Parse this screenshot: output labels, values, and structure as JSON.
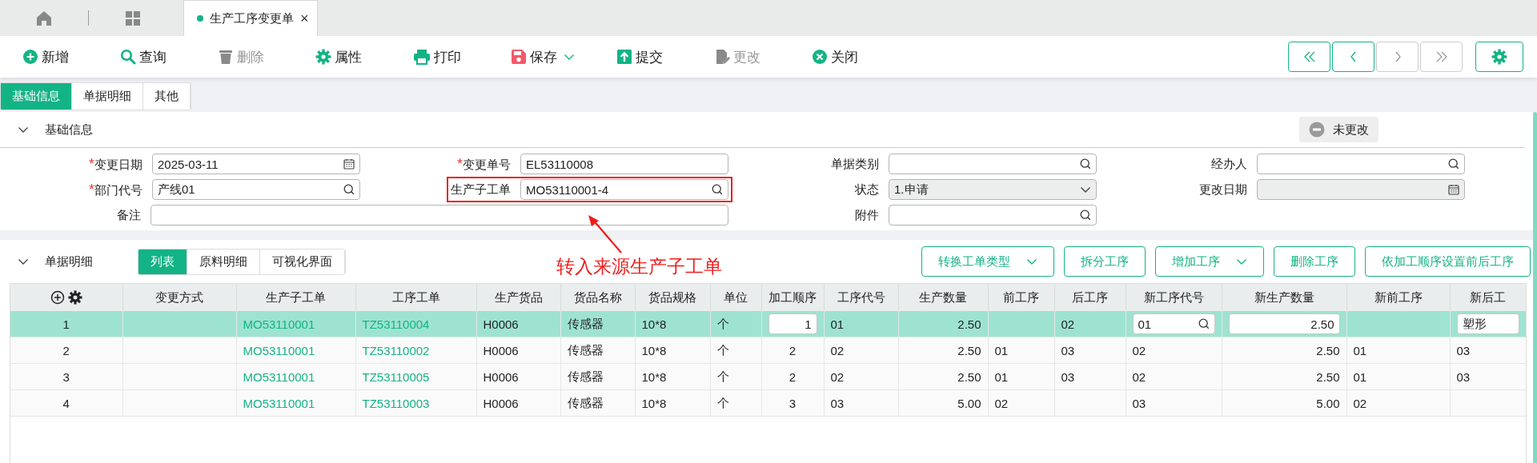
{
  "tab_bar": {
    "tabs": [
      {
        "label": "生产工序变更单",
        "selected": true,
        "close": "×"
      }
    ]
  },
  "toolbar": [
    {
      "label": "新增",
      "disabled": false
    },
    {
      "label": "查询",
      "disabled": false
    },
    {
      "label": "删除",
      "disabled": true
    },
    {
      "label": "属性",
      "disabled": false
    },
    {
      "label": "打印",
      "disabled": false
    },
    {
      "label": "保存",
      "disabled": false,
      "has_menu": true
    },
    {
      "label": "提交",
      "disabled": false
    },
    {
      "label": "更改",
      "disabled": true
    },
    {
      "label": "关闭",
      "disabled": false
    }
  ],
  "pager": [
    {
      "disabled": false
    },
    {
      "disabled": false
    },
    {
      "disabled": true
    },
    {
      "disabled": true
    }
  ],
  "form_tabs": [
    {
      "label": "基础信息",
      "selected": true
    },
    {
      "label": "单据明细",
      "selected": false
    },
    {
      "label": "其他",
      "selected": false
    }
  ],
  "basic_info": {
    "title": "基础信息",
    "expanded": true,
    "status": "未更改",
    "fields": [
      {
        "label": "变更日期",
        "kind": "date",
        "required_mark": "*",
        "disabled": false,
        "highlighted": false,
        "value": "2025-03-11"
      },
      {
        "label": "变更单号",
        "kind": "text",
        "required_mark": "*",
        "disabled": false,
        "highlighted": false,
        "value": "EL53110008"
      },
      {
        "label": "单据类别",
        "kind": "lookup",
        "disabled": false,
        "highlighted": false
      },
      {
        "label": "经办人",
        "kind": "lookup",
        "disabled": false,
        "highlighted": false
      },
      {
        "label": "部门代号",
        "kind": "lookup",
        "required_mark": "*",
        "disabled": false,
        "highlighted": false,
        "value": "产线01"
      },
      {
        "label": "生产子工单",
        "kind": "lookup",
        "disabled": false,
        "highlighted": true,
        "value": "MO53110001-4"
      },
      {
        "label": "状态",
        "kind": "select",
        "disabled": true,
        "highlighted": false,
        "value": "1.申请"
      },
      {
        "label": "更改日期",
        "kind": "date",
        "disabled": true,
        "highlighted": false
      },
      {
        "label": "备注",
        "kind": "note",
        "disabled": false,
        "highlighted": false
      },
      {
        "label": "附件",
        "kind": "lookup",
        "disabled": false,
        "highlighted": false
      }
    ]
  },
  "annotation": {
    "text": "转入来源生产子工单"
  },
  "detail": {
    "title": "单据明细",
    "expanded": true,
    "views": [
      {
        "label": "列表",
        "selected": true
      },
      {
        "label": "原料明细",
        "selected": false
      },
      {
        "label": "可视化界面",
        "selected": false
      }
    ],
    "actions": [
      {
        "label": "转换工单类型",
        "has_menu": true
      },
      {
        "label": "拆分工序",
        "has_menu": false
      },
      {
        "label": "增加工序",
        "has_menu": true
      },
      {
        "label": "删除工序",
        "has_menu": false
      },
      {
        "label": "依加工顺序设置前后工序",
        "has_menu": false
      }
    ],
    "table": {
      "columns": [
        {
          "kind": "index"
        },
        {
          "label": "变更方式",
          "kind": "text"
        },
        {
          "label": "生产子工单",
          "kind": "link"
        },
        {
          "label": "工序工单",
          "kind": "link"
        },
        {
          "label": "生产货品",
          "kind": "text"
        },
        {
          "label": "货品名称",
          "kind": "text"
        },
        {
          "label": "货品规格",
          "kind": "text"
        },
        {
          "label": "单位",
          "kind": "text"
        },
        {
          "label": "加工顺序",
          "kind": "center"
        },
        {
          "label": "工序代号",
          "kind": "text"
        },
        {
          "label": "生产数量",
          "kind": "number"
        },
        {
          "label": "前工序",
          "kind": "text"
        },
        {
          "label": "后工序",
          "kind": "text"
        },
        {
          "label": "新工序代号",
          "kind": "text"
        },
        {
          "label": "新生产数量",
          "kind": "number"
        },
        {
          "label": "新前工序",
          "kind": "text"
        },
        {
          "label": "新后工",
          "kind": "text"
        }
      ],
      "rows": [
        {
          "selected": true,
          "cells": [
            "1",
            null,
            "MO53110001",
            "TZ53110004",
            "H0006",
            "传感器",
            "10*8",
            "个",
            {
              "kind": "number_input",
              "value": "1"
            },
            "01",
            "2.50",
            null,
            "02",
            {
              "kind": "lookup_input",
              "value": "01"
            },
            {
              "kind": "number_input",
              "value": "2.50"
            },
            null,
            {
              "kind": "text_input",
              "value": "塑形"
            }
          ]
        },
        {
          "selected": false,
          "cells": [
            "2",
            null,
            "MO53110001",
            "TZ53110002",
            "H0006",
            "传感器",
            "10*8",
            "个",
            "2",
            "02",
            "2.50",
            "01",
            "03",
            "02",
            "2.50",
            "01",
            "03"
          ]
        },
        {
          "selected": false,
          "cells": [
            "3",
            null,
            "MO53110001",
            "TZ53110005",
            "H0006",
            "传感器",
            "10*8",
            "个",
            "2",
            "02",
            "2.50",
            "01",
            "03",
            "02",
            "2.50",
            "01",
            "03"
          ]
        },
        {
          "selected": false,
          "cells": [
            "4",
            null,
            "MO53110001",
            "TZ53110003",
            "H0006",
            "传感器",
            "10*8",
            "个",
            "3",
            "03",
            "5.00",
            "02",
            null,
            "03",
            "5.00",
            "02",
            null
          ]
        }
      ]
    }
  }
}
